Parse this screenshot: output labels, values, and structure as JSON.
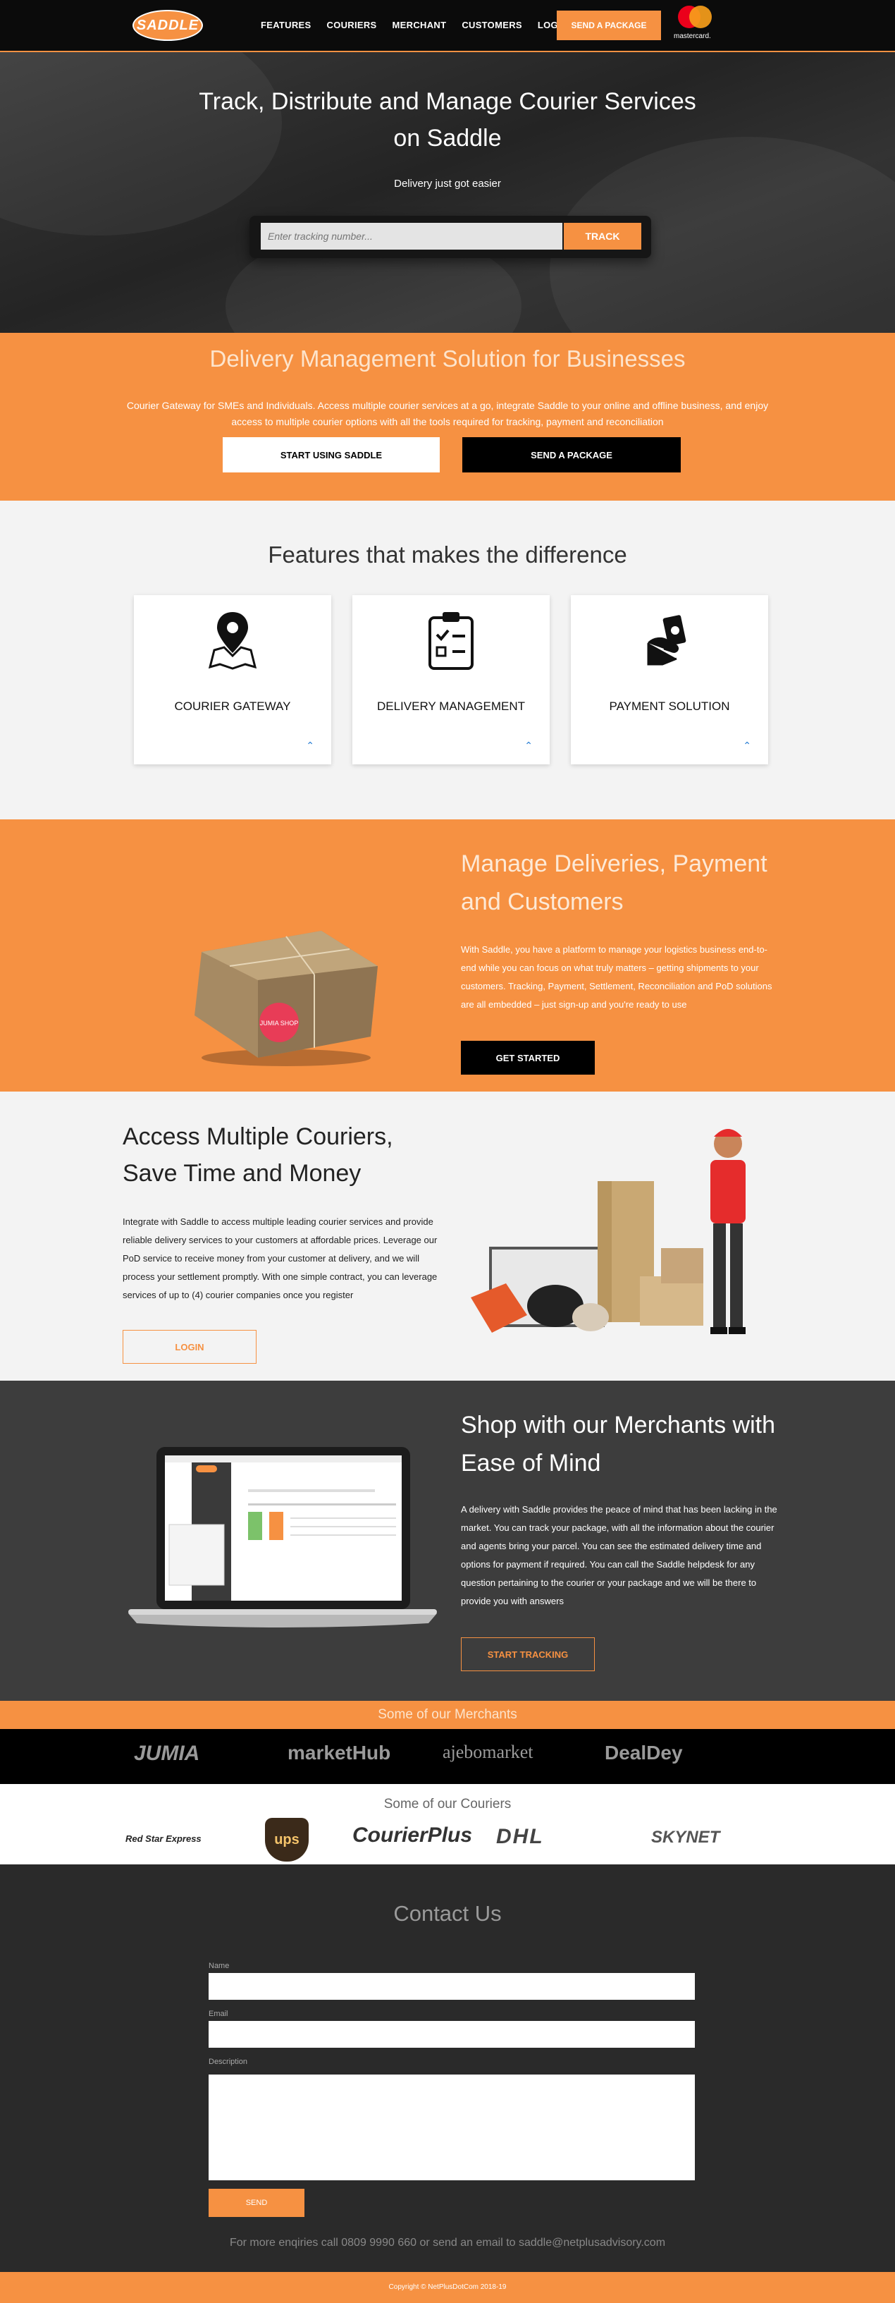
{
  "nav": {
    "logo": "SADDLE",
    "links": [
      "FEATURES",
      "COURIERS",
      "MERCHANT",
      "CUSTOMERS",
      "LOGIN"
    ],
    "cta": "SEND A PACKAGE",
    "mastercard": "mastercard."
  },
  "hero": {
    "title_line1": "Track, Distribute and Manage Courier Services",
    "title_line2": "on Saddle",
    "subtitle": "Delivery just got easier",
    "track_placeholder": "Enter tracking number...",
    "track_button": "TRACK"
  },
  "dms": {
    "title": "Delivery Management Solution for Businesses",
    "body": "Courier Gateway for SMEs and Individuals. Access multiple courier services at a go, integrate Saddle to your online and offline business, and enjoy access to multiple courier options with all the tools required for tracking, payment and reconciliation",
    "btn_start": "START USING SADDLE",
    "btn_send": "SEND A PACKAGE"
  },
  "features": {
    "title": "Features that makes the difference",
    "cards": [
      {
        "label": "COURIER GATEWAY",
        "icon": "map-pin-icon"
      },
      {
        "label": "DELIVERY MANAGEMENT",
        "icon": "clipboard-checklist-icon"
      },
      {
        "label": "PAYMENT SOLUTION",
        "icon": "hand-money-icon"
      }
    ]
  },
  "manage": {
    "title_line1": "Manage Deliveries, Payment",
    "title_line2": "and Customers",
    "body": "With Saddle, you have a platform to manage your logistics business end-to-end while you can focus on what truly matters – getting shipments to your customers. Tracking, Payment, Settlement, Reconciliation and PoD solutions are all embedded – just sign-up and you're ready to use",
    "button": "GET STARTED",
    "sticker": "JUMIA SHOP"
  },
  "access": {
    "title_line1": "Access Multiple Couriers,",
    "title_line2": "Save Time and Money",
    "body": "Integrate with Saddle to access multiple leading courier services and provide reliable delivery services to your customers at affordable prices. Leverage our PoD service to receive money from your customer at delivery, and we will process your settlement promptly. With one simple contract, you can leverage services of up to (4) courier companies once you register",
    "button": "LOGIN"
  },
  "shop": {
    "title_line1": "Shop with our Merchants with",
    "title_line2": "Ease of Mind",
    "body": "A delivery with Saddle provides the peace of mind that has been lacking in the market. You can track your package, with all the information about the courier and agents bring your parcel. You can see the estimated delivery time and options for payment if required. You can call the Saddle helpdesk for any question pertaining to the courier or your package and we will be there to provide you with answers",
    "button": "START TRACKING"
  },
  "merchants": {
    "title": "Some of our Merchants",
    "logos": [
      "JUMIA",
      "marketHub",
      "ajebomarket",
      "DealDey"
    ]
  },
  "couriers": {
    "title": "Some of our Couriers",
    "logos": [
      "Red Star Express",
      "ups",
      "CourierPlus",
      "DHL",
      "SKYNET"
    ]
  },
  "contact": {
    "title": "Contact Us",
    "name_label": "Name",
    "email_label": "Email",
    "description_label": "Description",
    "send": "SEND",
    "note": "For more enqiries call 0809 9990 660 or send an email to saddle@netplusadvisory.com"
  },
  "footer": {
    "copyright": "Copyright © NetPlusDotCom 2018-19"
  }
}
